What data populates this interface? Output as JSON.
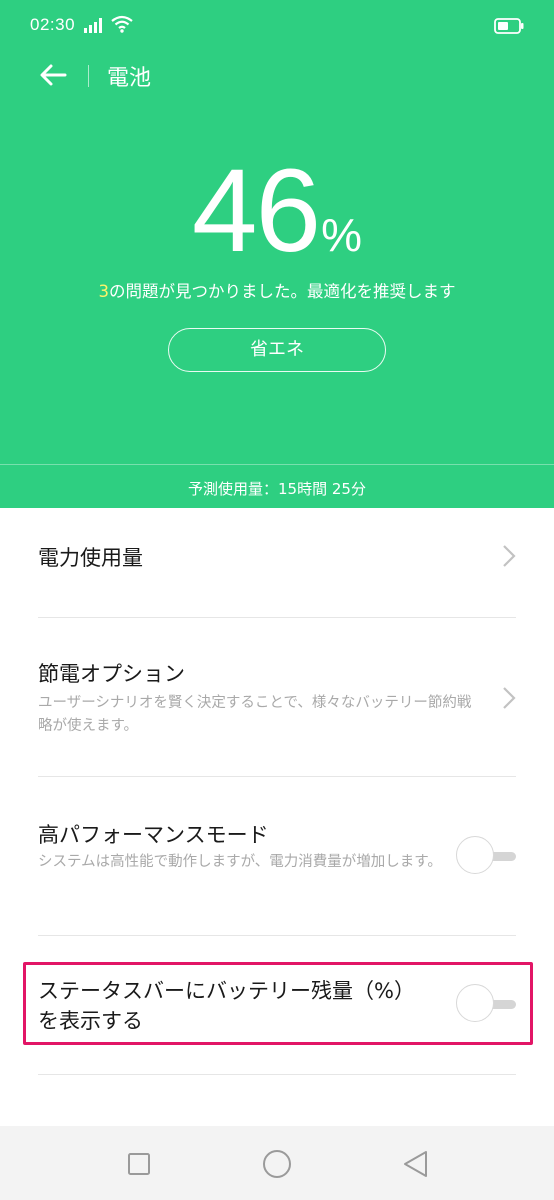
{
  "status_bar": {
    "time": "02:30"
  },
  "header": {
    "title": "電池"
  },
  "battery": {
    "percent": "46",
    "percent_sign": "%",
    "issue_count": "3",
    "issue_text": "の問題が見つかりました。最適化を推奨します",
    "save_label": "省エネ",
    "estimate": "予測使用量：15時間 25分"
  },
  "items": [
    {
      "title": "電力使用量"
    },
    {
      "title": "節電オプション",
      "desc": "ユーザーシナリオを賢く決定することで、様々なバッテリー節約戦略が使えます。"
    },
    {
      "title": "高パフォーマンスモード",
      "desc": "システムは高性能で動作しますが、電力消費量が増加します。",
      "toggle_on": false
    },
    {
      "title": "ステータスバーにバッテリー残量（%）を表示する",
      "toggle_on": false
    }
  ],
  "colors": {
    "accent": "#2ecf81",
    "highlight": "#e21566",
    "issue_count": "#fff36a"
  },
  "icons": [
    "signal-icon",
    "wifi-icon",
    "battery-icon",
    "back-arrow-icon",
    "chevron-right-icon",
    "square-icon",
    "circle-icon",
    "triangle-back-icon"
  ]
}
